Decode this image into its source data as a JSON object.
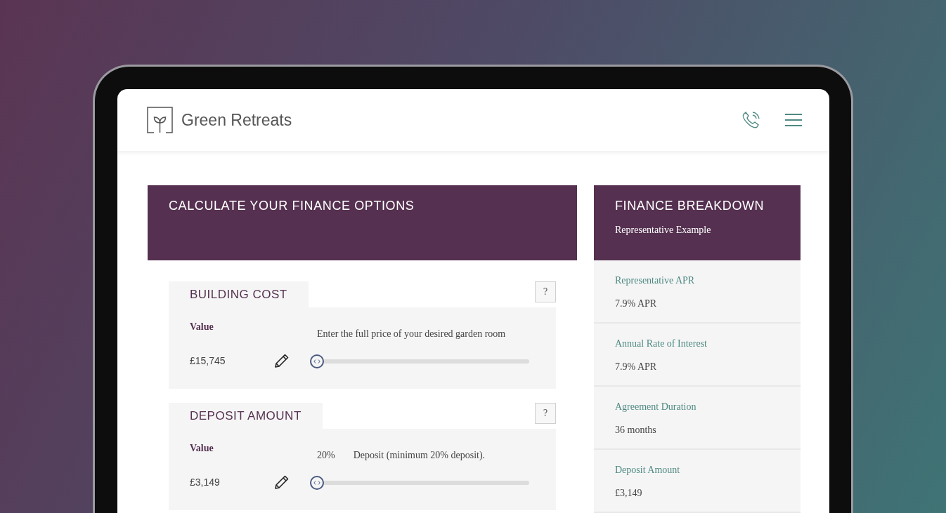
{
  "header": {
    "brand": "Green Retreats"
  },
  "calculator": {
    "title": "CALCULATE YOUR FINANCE OPTIONS",
    "sections": [
      {
        "title": "BUILDING COST",
        "help": "?",
        "value_label": "Value",
        "value": "£15,745",
        "description": "Enter the full price of your desired garden room",
        "slider": {
          "level": 0
        }
      },
      {
        "title": "DEPOSIT AMOUNT",
        "help": "?",
        "value_label": "Value",
        "value": "£3,149",
        "percent": "20%",
        "description": "Deposit (minimum 20% deposit).",
        "slider": {
          "level": 0
        }
      }
    ]
  },
  "breakdown": {
    "title": "FINANCE BREAKDOWN",
    "subtitle": "Representative Example",
    "rows": [
      {
        "label": "Representative APR",
        "value": "7.9% APR"
      },
      {
        "label": "Annual Rate of Interest",
        "value": "7.9% APR"
      },
      {
        "label": "Agreement Duration",
        "value": "36 months"
      },
      {
        "label": "Deposit Amount",
        "value": "£3,149"
      }
    ]
  }
}
